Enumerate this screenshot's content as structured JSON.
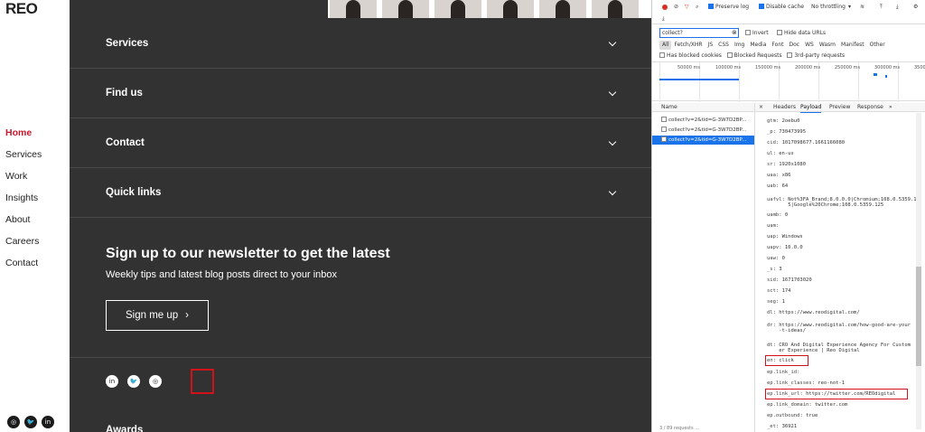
{
  "site": {
    "logo": "REO",
    "nav": [
      {
        "label": "Home",
        "active": true
      },
      {
        "label": "Services",
        "active": false
      },
      {
        "label": "Work",
        "active": false
      },
      {
        "label": "Insights",
        "active": false
      },
      {
        "label": "About",
        "active": false
      },
      {
        "label": "Careers",
        "active": false
      },
      {
        "label": "Contact",
        "active": false
      }
    ],
    "left_social_icons": [
      "instagram-icon",
      "twitter-icon",
      "linkedin-icon"
    ]
  },
  "footer": {
    "accordion": [
      "Services",
      "Find us",
      "Contact",
      "Quick links"
    ],
    "newsletter_title": "Sign up to our newsletter to get the latest",
    "newsletter_subtitle": "Weekly tips and latest blog posts direct to your inbox",
    "signup_label": "Sign me up",
    "signup_arrow": "›",
    "social_icons": [
      {
        "name": "linkedin-icon",
        "glyph": "in"
      },
      {
        "name": "twitter-icon",
        "glyph": "🐦"
      },
      {
        "name": "instagram-icon",
        "glyph": "◎"
      }
    ],
    "awards_title": "Awards",
    "highlight_color": "#d0121b"
  },
  "devtools": {
    "toolbar": {
      "preserve_log": "Preserve log",
      "disable_cache": "Disable cache",
      "throttling": "No throttling"
    },
    "filter_value": "collect?",
    "filter_options": {
      "invert": "Invert",
      "hide_data_urls": "Hide data URLs"
    },
    "types": [
      "All",
      "Fetch/XHR",
      "JS",
      "CSS",
      "Img",
      "Media",
      "Font",
      "Doc",
      "WS",
      "Wasm",
      "Manifest",
      "Other"
    ],
    "filter_row3": {
      "blocked_cookies": "Has blocked cookies",
      "blocked_requests": "Blocked Requests",
      "third_party": "3rd-party requests"
    },
    "timeline_labels": [
      "50000 ms",
      "100000 ms",
      "150000 ms",
      "200000 ms",
      "250000 ms",
      "300000 ms",
      "3500"
    ],
    "requests_header": "Name",
    "requests": [
      "collect?v=2&tid=G-3W7D2BP...",
      "collect?v=2&tid=G-3W7D2BP...",
      "collect?v=2&tid=G-3W7D2BP..."
    ],
    "tabs": [
      "Headers",
      "Payload",
      "Preview",
      "Response"
    ],
    "selected_tab": "Payload",
    "payload": [
      {
        "k": "gtm",
        "v": "2oebu0"
      },
      {
        "k": "_p",
        "v": "730473995"
      },
      {
        "k": "cid",
        "v": "1017098677.1661166080"
      },
      {
        "k": "ul",
        "v": "en-us"
      },
      {
        "k": "sr",
        "v": "1920x1080"
      },
      {
        "k": "uaa",
        "v": "x86"
      },
      {
        "k": "uab",
        "v": "64"
      },
      {
        "k": "uafvl",
        "v": "Not%3FA_Brand;8.0.0.0|Chromium;108.0.5359.125|Google%20Chrome;108.0.5359.125"
      },
      {
        "k": "uamb",
        "v": "0"
      },
      {
        "k": "uam",
        "v": ""
      },
      {
        "k": "uap",
        "v": "Windows"
      },
      {
        "k": "uapv",
        "v": "10.0.0"
      },
      {
        "k": "uaw",
        "v": "0"
      },
      {
        "k": "_s",
        "v": "3"
      },
      {
        "k": "sid",
        "v": "1671703020"
      },
      {
        "k": "sct",
        "v": "174"
      },
      {
        "k": "seg",
        "v": "1"
      },
      {
        "k": "dl",
        "v": "https://www.reodigital.com/"
      },
      {
        "k": "dr",
        "v": "https://www.reodigital.com/how-good-are-your-t-ideas/"
      },
      {
        "k": "dt",
        "v": "CRO And Digital Experience Agency For Customer Experience | Reo Digital"
      },
      {
        "k": "en",
        "v": "click"
      },
      {
        "k": "ep.link_id",
        "v": ""
      },
      {
        "k": "ep.link_classes",
        "v": "reo-not-1"
      },
      {
        "k": "ep.link_url",
        "v": "https://twitter.com/REOdigital"
      },
      {
        "k": "ep.link_domain",
        "v": "twitter.com"
      },
      {
        "k": "ep.outbound",
        "v": "true"
      },
      {
        "k": "_et",
        "v": "36921"
      }
    ],
    "status": "3 / 89 requests   ..."
  }
}
